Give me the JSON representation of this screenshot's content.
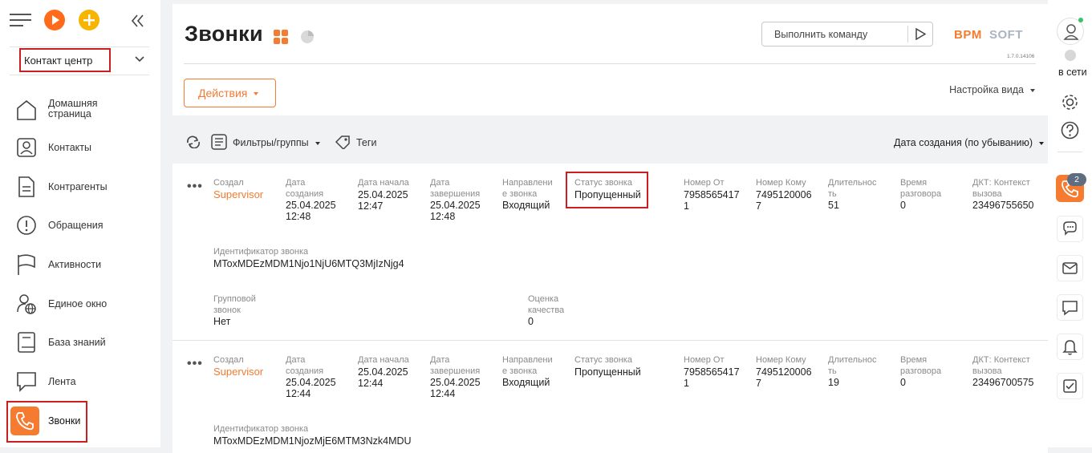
{
  "sidebar": {
    "workspace": "Контакт центр",
    "items": [
      {
        "label": "Домашняя\nстраница",
        "icon": "home-icon"
      },
      {
        "label": "Контакты",
        "icon": "contact-icon"
      },
      {
        "label": "Контрагенты",
        "icon": "document-icon"
      },
      {
        "label": "Обращения",
        "icon": "alert-icon"
      },
      {
        "label": "Активности",
        "icon": "flag-icon"
      },
      {
        "label": "Единое окно",
        "icon": "globe-user-icon"
      },
      {
        "label": "База знаний",
        "icon": "book-icon"
      },
      {
        "label": "Лента",
        "icon": "message-icon"
      },
      {
        "label": "Звонки",
        "icon": "phone-icon"
      }
    ]
  },
  "header": {
    "title": "Звонки",
    "command_placeholder": "Выполнить команду",
    "logo": "BPMSOFT",
    "version": "1.7.0.14106",
    "actions": "Действия",
    "view_settings": "Настройка вида"
  },
  "toolbar": {
    "filters": "Фильтры/группы",
    "tags": "Теги",
    "sort": "Дата создания (по убыванию)"
  },
  "captions": {
    "created_by": "Создал",
    "created_date": "Дата\nсоздания",
    "start_date": "Дата начала",
    "end_date": "Дата\nзавершения",
    "direction": "Направлени\nе звонка",
    "status": "Статус звонка",
    "from": "Номер От",
    "to": "Номер Кому",
    "duration": "Длительнос\nть",
    "talk_time": "Время\nразговора",
    "dkt": "ДКТ: Контекст\nвызова",
    "call_id": "Идентификатор звонка",
    "group_call": "Групповой\nзвонок",
    "quality": "Оценка\nкачества"
  },
  "records": [
    {
      "created_by": "Supervisor",
      "created_date": "25.04.2025\n12:48",
      "start_date": "25.04.2025\n12:47",
      "end_date": "25.04.2025\n12:48",
      "direction": "Входящий",
      "status": "Пропущенный",
      "from": "7958565417\n1",
      "to": "7495120006\n7",
      "duration": "51",
      "talk_time": "0",
      "dkt": "23496755650",
      "call_id": "MToxMDEzMDM1Njo1NjU6MTQ3MjIzNjg4",
      "group_call": "Нет",
      "quality": "0"
    },
    {
      "created_by": "Supervisor",
      "created_date": "25.04.2025\n12:44",
      "start_date": "25.04.2025\n12:44",
      "end_date": "25.04.2025\n12:44",
      "direction": "Входящий",
      "status": "Пропущенный",
      "from": "7958565417\n1",
      "to": "7495120006\n7",
      "duration": "19",
      "talk_time": "0",
      "dkt": "23496700575",
      "call_id": "MToxMDEzMDM1NjozMjE6MTM3Nzk4MDU"
    }
  ],
  "rightbar": {
    "status": "в сети",
    "badge": "2"
  },
  "colors": {
    "accent": "#f47b30",
    "highlight": "#cc1e1e",
    "online": "#3cc26b"
  }
}
